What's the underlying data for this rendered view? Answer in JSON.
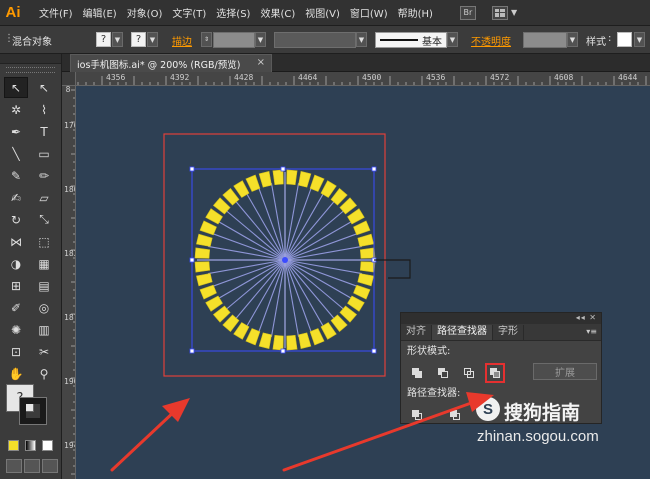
{
  "app": {
    "logo": "Ai"
  },
  "menubar": {
    "items": [
      "文件(F)",
      "编辑(E)",
      "对象(O)",
      "文字(T)",
      "选择(S)",
      "效果(C)",
      "视图(V)",
      "窗口(W)",
      "帮助(H)"
    ],
    "bridge_label": "Br"
  },
  "controlbar": {
    "selection": "混合对象",
    "fill_swatch": "?",
    "stroke_swatch": "?",
    "stroke_label": "描边",
    "stroke_style": "基本",
    "opacity_label": "不透明度",
    "style_label": "样式"
  },
  "document": {
    "tab_title": "ios手机图标.ai* @ 200% (RGB/预览)",
    "close": "×"
  },
  "rulers": {
    "h_labels": [
      "4356",
      "4392",
      "4428",
      "4464",
      "4500",
      "4536",
      "4572",
      "4608",
      "4644"
    ],
    "v_labels": [
      "8",
      "1764",
      "1800",
      "1836",
      "1872",
      "1908",
      "1944"
    ]
  },
  "tools": {
    "icons": [
      "selection-icon",
      "direct-selection-icon",
      "magic-wand-icon",
      "lasso-icon",
      "pen-icon",
      "type-icon",
      "line-icon",
      "rectangle-icon",
      "paintbrush-icon",
      "pencil-icon",
      "blob-brush-icon",
      "eraser-icon",
      "rotate-icon",
      "scale-icon",
      "width-icon",
      "free-transform-icon",
      "shape-builder-icon",
      "perspective-icon",
      "mesh-icon",
      "gradient-icon",
      "eyedropper-icon",
      "blend-icon",
      "symbol-sprayer-icon",
      "column-graph-icon",
      "artboard-icon",
      "slice-icon",
      "hand-icon",
      "zoom-icon"
    ],
    "glyphs": [
      "↖",
      "↖",
      "✲",
      "⌇",
      "✒",
      "T",
      "╲",
      "▭",
      "✎",
      "✏",
      "✍",
      "▱",
      "↻",
      "⤡",
      "⋈",
      "⬚",
      "◑",
      "▦",
      "⊞",
      "▤",
      "✐",
      "◎",
      "✺",
      "▥",
      "⊡",
      "✂",
      "✋",
      "⚲"
    ],
    "fill_label": "?"
  },
  "pathfinder": {
    "tabs": [
      "对齐",
      "路径查找器",
      "字形"
    ],
    "active_tab": 1,
    "shape_modes_label": "形状模式:",
    "pathfinders_label": "路径查找器:",
    "expand_label": "扩展",
    "shape_mode_buttons": [
      "unite-icon",
      "minus-front-icon",
      "intersect-icon",
      "exclude-icon"
    ],
    "highlighted_button": "exclude-icon"
  },
  "watermark": {
    "logo": "S",
    "title": "搜狗指南",
    "url": "zhinan.sogou.com"
  },
  "colors": {
    "canvas": "#2e4054",
    "ring": "#f5e02a",
    "rays": "#8f96d8",
    "selection": "#3b4bff",
    "artboard_border": "#e0403a",
    "arrow": "#e8392c",
    "accent": "#ff9a00"
  }
}
